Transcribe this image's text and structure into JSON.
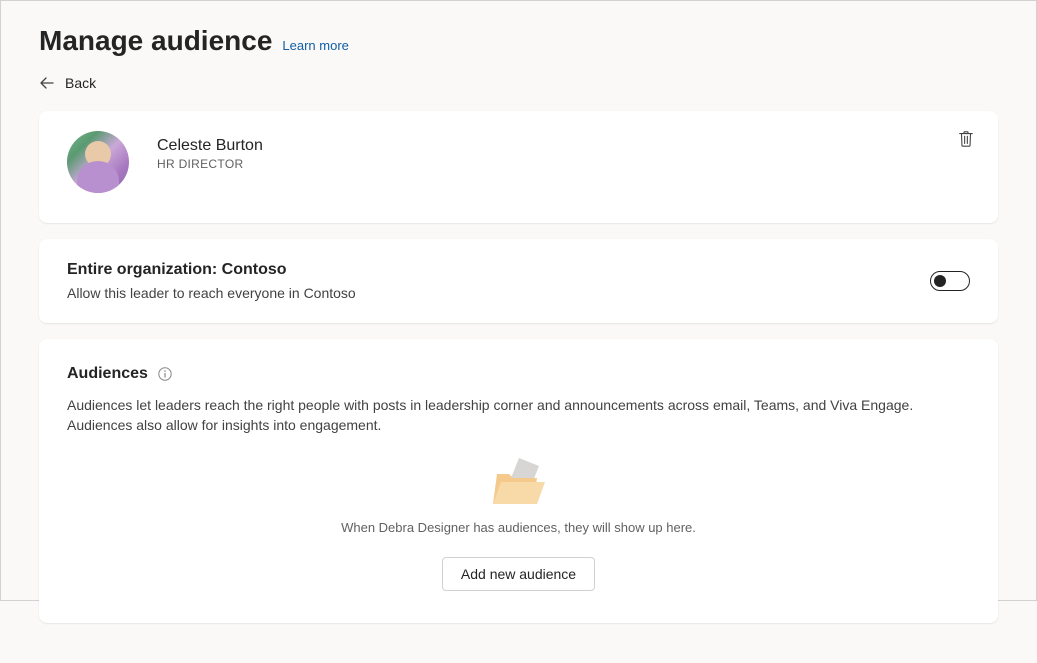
{
  "header": {
    "title": "Manage audience",
    "learn_more": "Learn more"
  },
  "nav": {
    "back": "Back"
  },
  "leader": {
    "name": "Celeste Burton",
    "role": "HR DIRECTOR"
  },
  "organization": {
    "title": "Entire organization: Contoso",
    "description": "Allow this leader to reach everyone in Contoso",
    "toggle_on": false
  },
  "audiences": {
    "title": "Audiences",
    "description": "Audiences let leaders reach the right people with posts in leadership corner and announcements across email, Teams, and Viva Engage. Audiences also allow for insights into engagement.",
    "empty_text": "When Debra Designer has audiences, they will show up here.",
    "add_button": "Add new audience"
  }
}
